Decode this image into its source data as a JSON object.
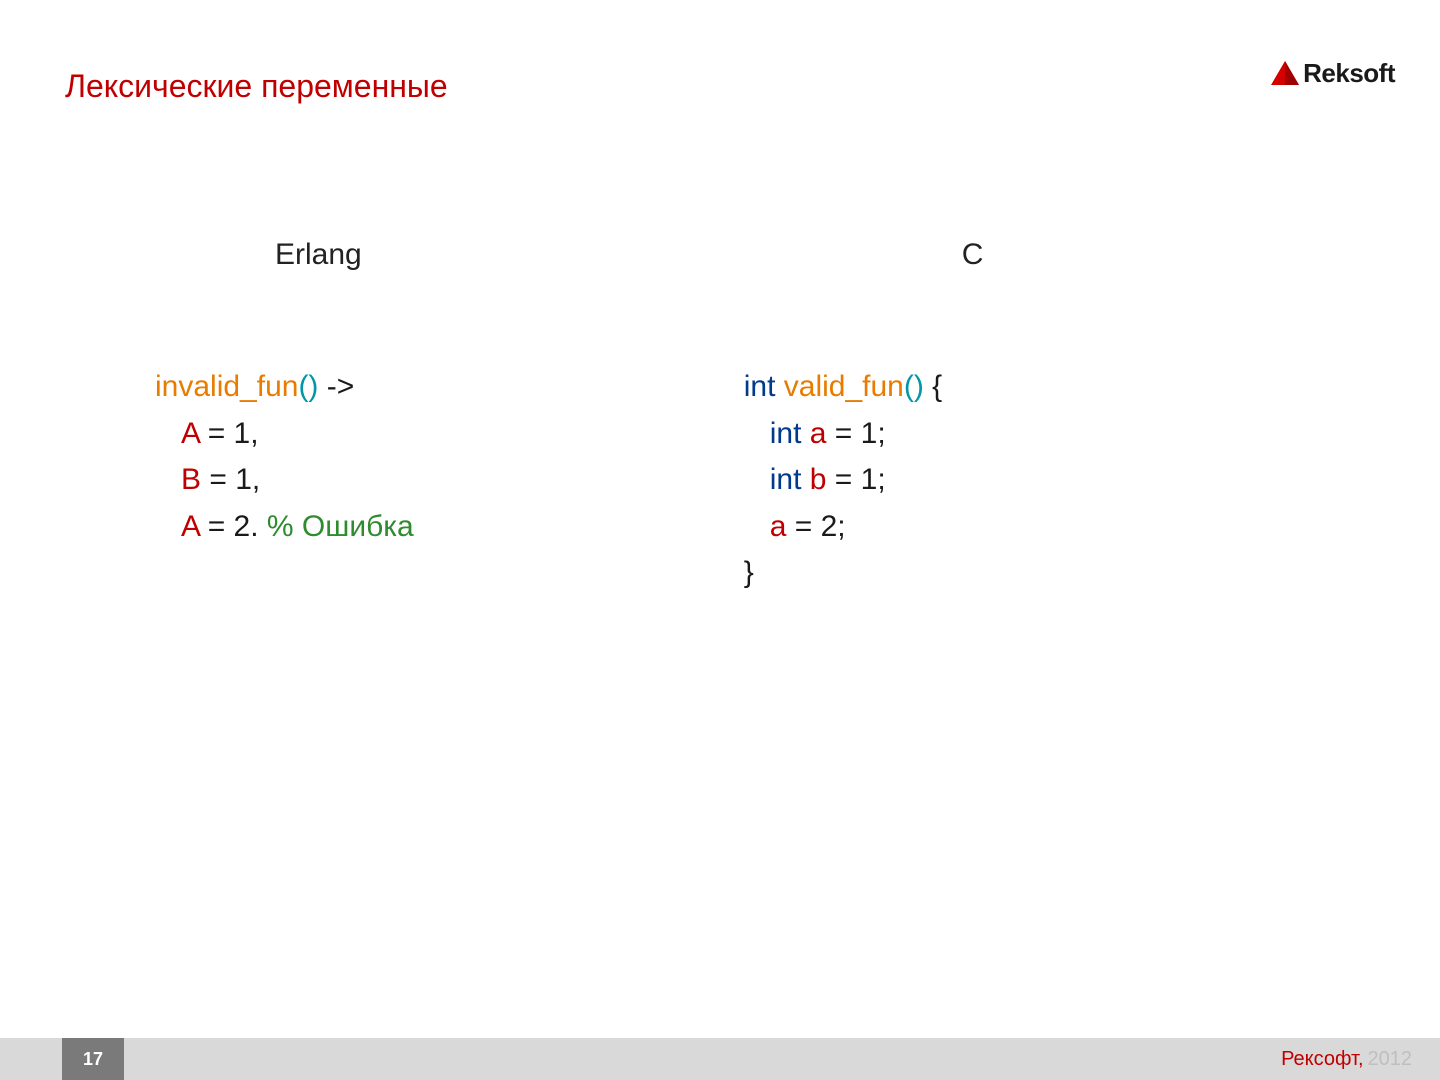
{
  "title": "Лексические переменные",
  "logo": {
    "brand": "Reksoft"
  },
  "columns": {
    "left": {
      "header": "Erlang",
      "code": {
        "l1_fn": "invalid_fun",
        "l1_paren": "()",
        "l1_arrow": " ->",
        "l2_var": "A",
        "l2_rest": " = 1,",
        "l3_var": "B",
        "l3_rest": " = 1,",
        "l4_var": "A",
        "l4_eq": " = 2. ",
        "l4_comment": "% Ошибка"
      }
    },
    "right": {
      "header": "C",
      "code": {
        "l1_type": "int",
        "l1_space": " ",
        "l1_fn": "valid_fun",
        "l1_paren": "()",
        "l1_brace": " {",
        "l2_type": "int",
        "l2_space": " ",
        "l2_var": "a",
        "l2_rest": " = 1;",
        "l3_type": "int",
        "l3_space": " ",
        "l3_var": "b",
        "l3_rest": " = 1;",
        "l4_var": "a",
        "l4_rest": " = 2;",
        "l5_brace": "}"
      }
    }
  },
  "footer": {
    "page": "17",
    "company": "Рексофт,",
    "year": "2012"
  }
}
